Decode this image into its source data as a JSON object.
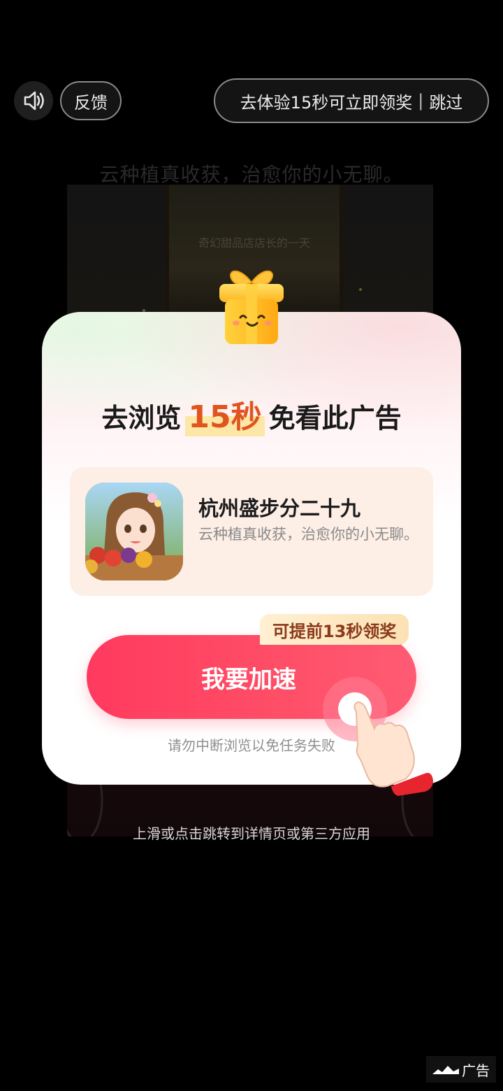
{
  "top_bar": {
    "sound_icon": "speaker-icon",
    "feedback_label": "反馈",
    "skip_text": "去体验15秒可立即领奖",
    "skip_separator": "|",
    "skip_label": "跳过"
  },
  "background_ad": {
    "caption": "云种植真收获，治愈你的小无聊。",
    "window_text": "奇幻甜品店店长的一天",
    "bottom_text": "上滑或点击跳转到详情页或第三方应用"
  },
  "modal": {
    "gift_icon": "gift-box-icon",
    "title_prefix": "去浏览",
    "title_highlight": "15秒",
    "title_suffix": "免看此广告",
    "app": {
      "name": "杭州盛步分二十九",
      "description": "云种植真收获，治愈你的小无聊。"
    },
    "badge_text": "可提前13秒领奖",
    "speed_button_label": "我要加速",
    "hint_text": "请勿中断浏览以免任务失败"
  },
  "ad_tag": {
    "label": "广告"
  },
  "colors": {
    "accent_red": "#ff3a5f",
    "highlight_orange": "#e0541d",
    "card_bg": "#fdeee6",
    "badge_bg": "#fce1b4"
  }
}
